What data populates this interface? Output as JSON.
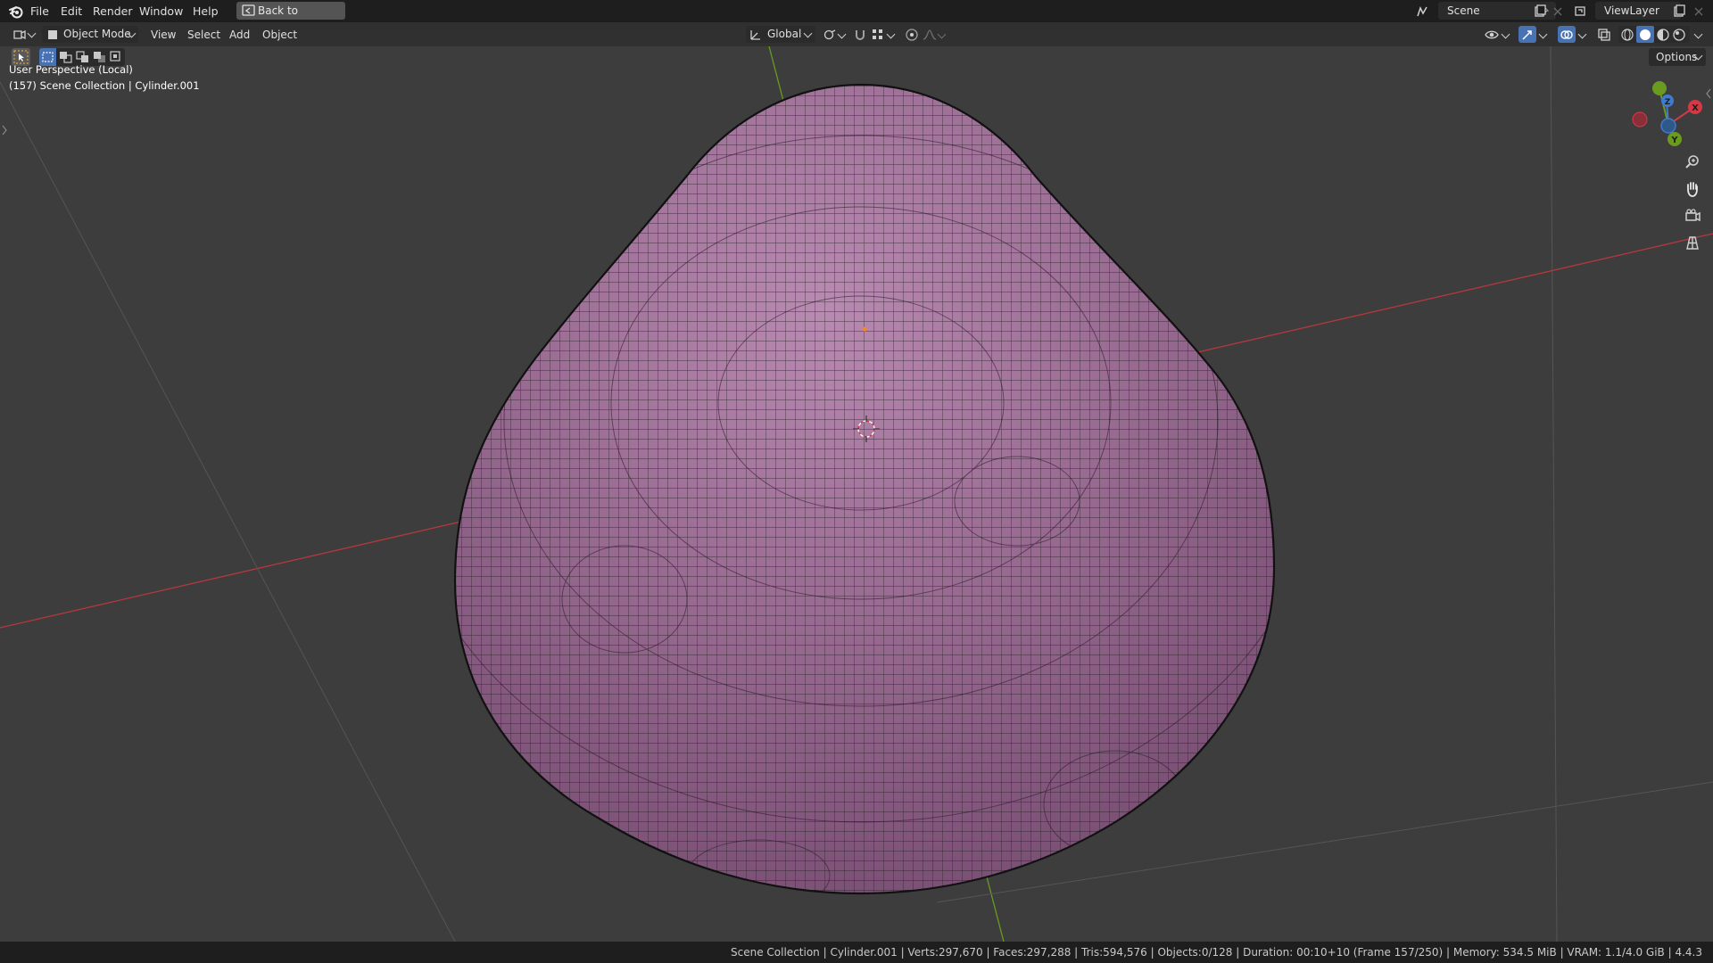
{
  "topbar": {
    "menus": [
      "File",
      "Edit",
      "Render",
      "Window",
      "Help"
    ],
    "back_button": "Back to Previous",
    "scene_label": "Scene",
    "viewlayer_label": "ViewLayer"
  },
  "header": {
    "mode_label": "Object Mode",
    "menus": [
      "View",
      "Select",
      "Add",
      "Object"
    ],
    "transform_orientation": "Global",
    "options_label": "Options"
  },
  "viewport": {
    "perspective_label": "User Perspective (Local)",
    "collection_label": "(157) Scene Collection | Cylinder.001",
    "gizmo_axes": {
      "x": "X",
      "y": "Y",
      "z": "Z"
    },
    "mesh_color": "#9a6a92",
    "wire_color": "#1c1c1c",
    "x_axis_color": "#b5383d",
    "y_axis_color": "#6a9a1f"
  },
  "statusbar": {
    "text": "Scene Collection | Cylinder.001 | Verts:297,670 | Faces:297,288 | Tris:594,576 | Objects:0/128 | Duration: 00:10+10 (Frame 157/250) | Memory: 534.5 MiB | VRAM: 1.1/4.0 GiB | 4.4.3"
  }
}
